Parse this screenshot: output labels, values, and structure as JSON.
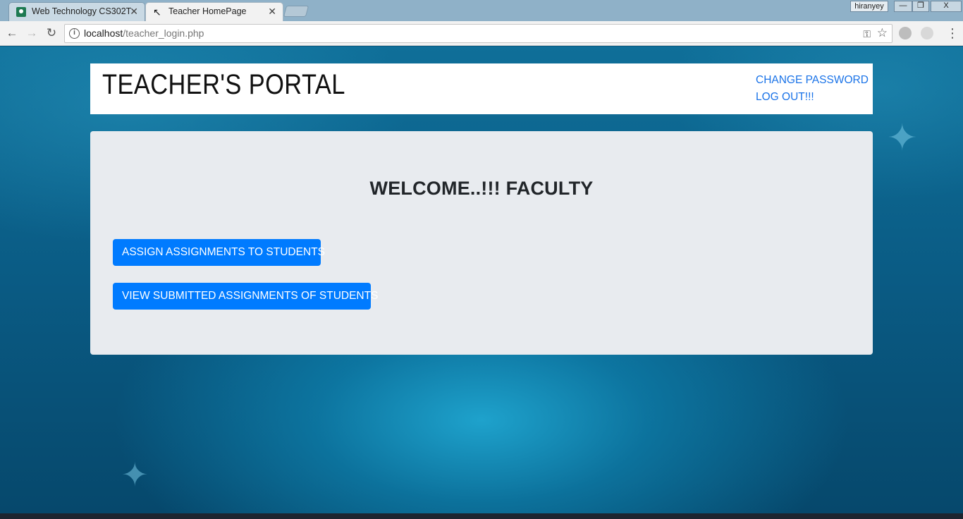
{
  "browser": {
    "tabs": [
      {
        "title": "Web Technology CS302T",
        "favicon": "classroom-icon",
        "active": false
      },
      {
        "title": "Teacher HomePage",
        "favicon": "cursor-icon",
        "active": true
      }
    ],
    "tab_close": "✕",
    "user": "hiranyey",
    "window_buttons": {
      "minimize": "—",
      "maximize": "❐",
      "close": "X"
    },
    "url_host": "localhost",
    "url_path": "/teacher_login.php"
  },
  "header": {
    "title": "TEACHER'S PORTAL",
    "links": {
      "change_password": "CHANGE PASSWORD",
      "logout": "LOG OUT!!!"
    }
  },
  "main": {
    "welcome": "WELCOME..!!! FACULTY",
    "buttons": {
      "assign": "ASSIGN ASSIGNMENTS TO STUDENTS",
      "view": "VIEW SUBMITTED ASSIGNMENTS OF STUDENTS"
    }
  },
  "colors": {
    "primary_button": "#007bff",
    "link": "#1a73e8",
    "panel": "#e8ebef"
  }
}
